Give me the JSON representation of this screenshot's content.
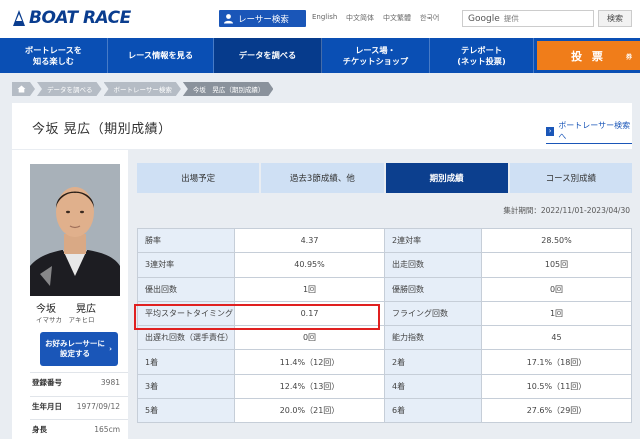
{
  "header": {
    "logo_text": "BOAT RACE",
    "racer_search_label": "レーサー検索",
    "languages": [
      "English",
      "中文简体",
      "中文繁體",
      "한국어"
    ],
    "google_label": "Google",
    "google_placeholder": "提供",
    "search_button": "検索"
  },
  "nav": {
    "items": [
      {
        "label": "ボートレースを\n知る楽しむ"
      },
      {
        "label": "レース情報を見る"
      },
      {
        "label": "データを調べる"
      },
      {
        "label": "レース場・\nチケットショップ"
      },
      {
        "label": "テレボート\n(ネット投票)"
      }
    ],
    "vote_label": "投 票",
    "vote_sub": "券"
  },
  "breadcrumb": [
    "データを調べる",
    "ボートレーサー検索",
    "今坂　晃広（期別成績）"
  ],
  "page": {
    "title": "今坂 晃広（期別成績）",
    "back_link": "ボートレーサー検索へ"
  },
  "profile": {
    "name": "今坂　　晃広",
    "kana": "イマサカ　アキヒロ",
    "fav_button": "お好みレーサーに\n設定する",
    "rows": [
      {
        "label": "登録番号",
        "value": "3981"
      },
      {
        "label": "生年月日",
        "value": "1977/09/12"
      },
      {
        "label": "身長",
        "value": "165cm"
      }
    ]
  },
  "tabs": [
    "出場予定",
    "過去3節成績、他",
    "期別成績",
    "コース別成績"
  ],
  "period": "集計期間：2022/11/01-2023/04/30",
  "stats": [
    [
      {
        "k": "勝率",
        "v": "4.37"
      },
      {
        "k": "2連対率",
        "v": "28.50%"
      }
    ],
    [
      {
        "k": "3連対率",
        "v": "40.95%"
      },
      {
        "k": "出走回数",
        "v": "105回"
      }
    ],
    [
      {
        "k": "優出回数",
        "v": "1回"
      },
      {
        "k": "優勝回数",
        "v": "0回"
      }
    ],
    [
      {
        "k": "平均スタートタイミング",
        "v": "0.17"
      },
      {
        "k": "フライング回数",
        "v": "1回"
      }
    ],
    [
      {
        "k": "出遅れ回数（選手責任）",
        "v": "0回"
      },
      {
        "k": "能力指数",
        "v": "45"
      }
    ],
    [
      {
        "k": "1着",
        "v": "11.4%（12回）"
      },
      {
        "k": "2着",
        "v": "17.1%（18回）"
      }
    ],
    [
      {
        "k": "3着",
        "v": "12.4%（13回）"
      },
      {
        "k": "4着",
        "v": "10.5%（11回）"
      }
    ],
    [
      {
        "k": "5着",
        "v": "20.0%（21回）"
      },
      {
        "k": "6着",
        "v": "27.6%（29回）"
      }
    ]
  ]
}
